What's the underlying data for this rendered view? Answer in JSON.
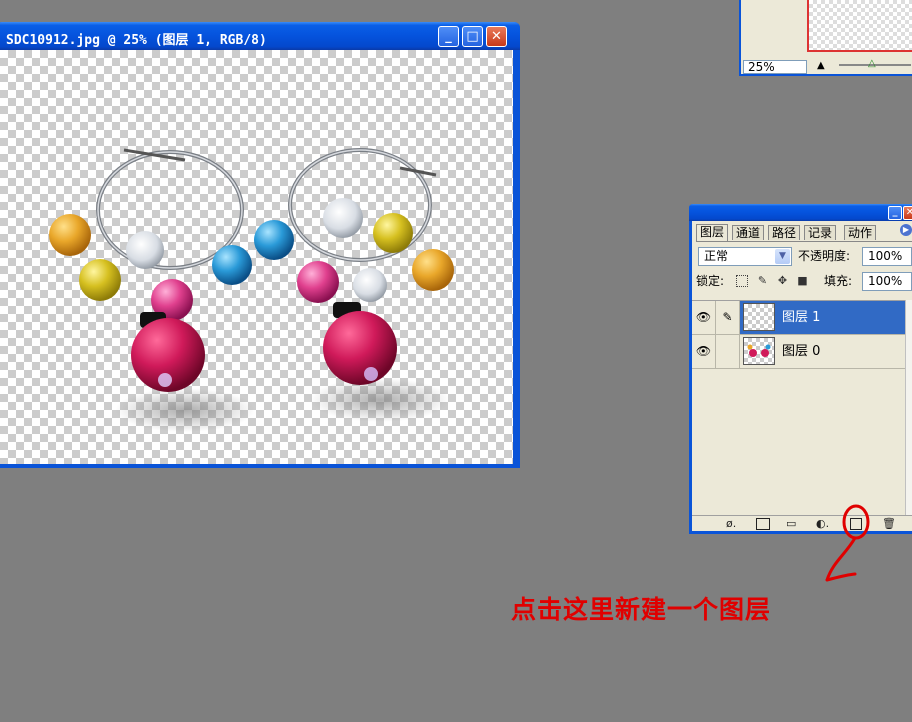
{
  "document_window": {
    "title": "SDC10912.jpg @ 25% (图层 1, RGB/8)",
    "minimize_glyph": "_",
    "maximize_glyph": "□",
    "close_glyph": "✕"
  },
  "navigator": {
    "zoom_value": "25%"
  },
  "layers_panel": {
    "tabs": [
      {
        "label": "图层",
        "active": true
      },
      {
        "label": "通道",
        "active": false
      },
      {
        "label": "路径",
        "active": false
      },
      {
        "label": "记录",
        "active": false
      },
      {
        "label": "动作",
        "active": false
      }
    ],
    "blend_mode": "正常",
    "opacity_label": "不透明度:",
    "opacity_value": "100%",
    "lock_label": "锁定:",
    "fill_label": "填充:",
    "fill_value": "100%",
    "layers": [
      {
        "name": "图层 1",
        "selected": true
      },
      {
        "name": "图层 0",
        "selected": false
      }
    ],
    "eye_glyph": "👁",
    "brush_glyph": "✎"
  },
  "annotation": {
    "text": "点击这里新建一个图层",
    "color": "#e00000"
  },
  "colors": {
    "desktop": "#7f7f7f",
    "xp_blue": "#0a54d8",
    "selection": "#316ac5"
  }
}
